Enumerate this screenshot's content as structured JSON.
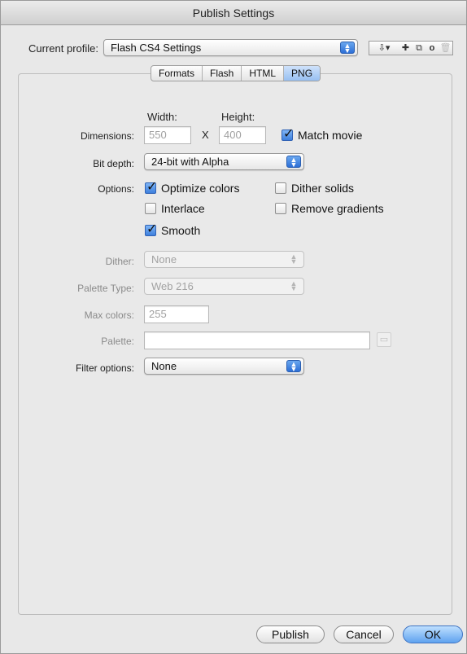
{
  "window": {
    "title": "Publish Settings"
  },
  "profile": {
    "label": "Current profile:",
    "value": "Flash CS4 Settings"
  },
  "toolbar_icons": [
    "import-export-icon",
    "add-profile-icon",
    "duplicate-profile-icon",
    "profile-info-icon",
    "delete-profile-icon"
  ],
  "tabs": [
    {
      "label": "Formats",
      "active": false
    },
    {
      "label": "Flash",
      "active": false
    },
    {
      "label": "HTML",
      "active": false
    },
    {
      "label": "PNG",
      "active": true
    }
  ],
  "dimensions": {
    "label": "Dimensions:",
    "width_label": "Width:",
    "height_label": "Height:",
    "width_value": "550",
    "separator": "X",
    "height_value": "400",
    "match_movie_label": "Match movie",
    "match_movie_checked": true
  },
  "bit_depth": {
    "label": "Bit depth:",
    "value": "24-bit with Alpha"
  },
  "options": {
    "label": "Options:",
    "optimize_colors": {
      "label": "Optimize colors",
      "checked": true
    },
    "dither_solids": {
      "label": "Dither solids",
      "checked": false
    },
    "interlace": {
      "label": "Interlace",
      "checked": false
    },
    "remove_gradients": {
      "label": "Remove gradients",
      "checked": false
    },
    "smooth": {
      "label": "Smooth",
      "checked": true
    }
  },
  "dither": {
    "label": "Dither:",
    "value": "None"
  },
  "palette_type": {
    "label": "Palette Type:",
    "value": "Web 216"
  },
  "max_colors": {
    "label": "Max colors:",
    "value": "255"
  },
  "palette": {
    "label": "Palette:",
    "value": ""
  },
  "filter_options": {
    "label": "Filter options:",
    "value": "None"
  },
  "buttons": {
    "publish": "Publish",
    "cancel": "Cancel",
    "ok": "OK"
  },
  "colors": {
    "accent": "#3e80dd",
    "window_bg": "#e8e8e8"
  }
}
